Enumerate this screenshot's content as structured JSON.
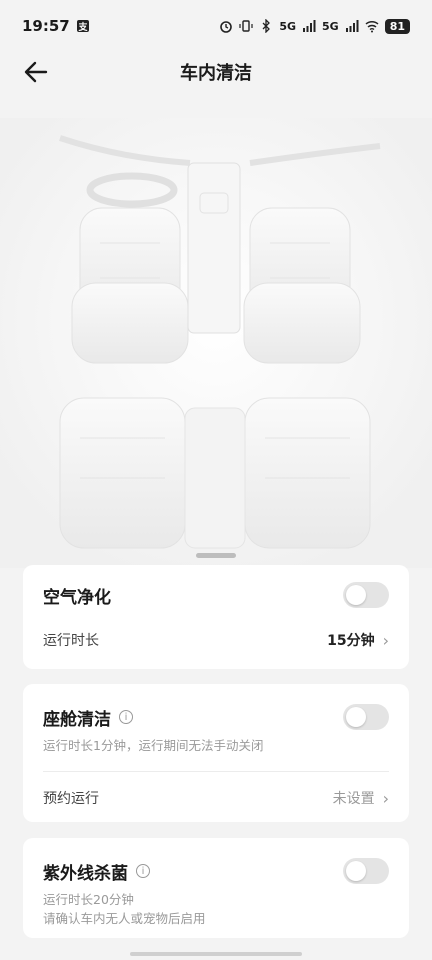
{
  "status": {
    "time": "19:57",
    "battery": "81",
    "net1": "5G",
    "net2": "5G"
  },
  "header": {
    "title": "车内清洁"
  },
  "air": {
    "title": "空气净化",
    "row_label": "运行时长",
    "row_value": "15分钟",
    "enabled": false
  },
  "seat": {
    "title": "座舱清洁",
    "desc": "运行时长1分钟，运行期间无法手动关闭",
    "row_label": "预约运行",
    "row_value": "未设置",
    "enabled": false
  },
  "uv": {
    "title": "紫外线杀菌",
    "desc1": "运行时长20分钟",
    "desc2": "请确认车内无人或宠物后启用",
    "enabled": false
  }
}
